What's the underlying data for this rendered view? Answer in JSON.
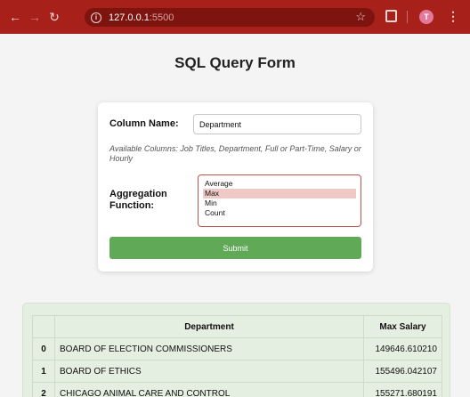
{
  "browser": {
    "url_host": "127.0.0.1",
    "url_port": ":5500",
    "back_icon": "back-arrow-icon",
    "forward_icon": "forward-arrow-icon",
    "reload_icon": "reload-icon",
    "profile_initial": "T"
  },
  "page": {
    "title": "SQL Query Form"
  },
  "form": {
    "column_label": "Column Name:",
    "column_value": "Department",
    "available_text": "Available Columns: Job Titles, Department, Full or Part-Time, Salary or Hourly",
    "aggregation_label": "Aggregation Function:",
    "aggregation_options": [
      "Average",
      "Max",
      "Min",
      "Count"
    ],
    "aggregation_selected": "Max",
    "submit_label": "Submit"
  },
  "results": {
    "headers": [
      "",
      "Department",
      "Max Salary"
    ],
    "rows": [
      {
        "index": "0",
        "department": "BOARD OF ELECTION COMMISSIONERS",
        "value": "149646.610210"
      },
      {
        "index": "1",
        "department": "BOARD OF ETHICS",
        "value": "155496.042107"
      },
      {
        "index": "2",
        "department": "CHICAGO ANIMAL CARE AND CONTROL",
        "value": "155271.680191"
      }
    ]
  }
}
